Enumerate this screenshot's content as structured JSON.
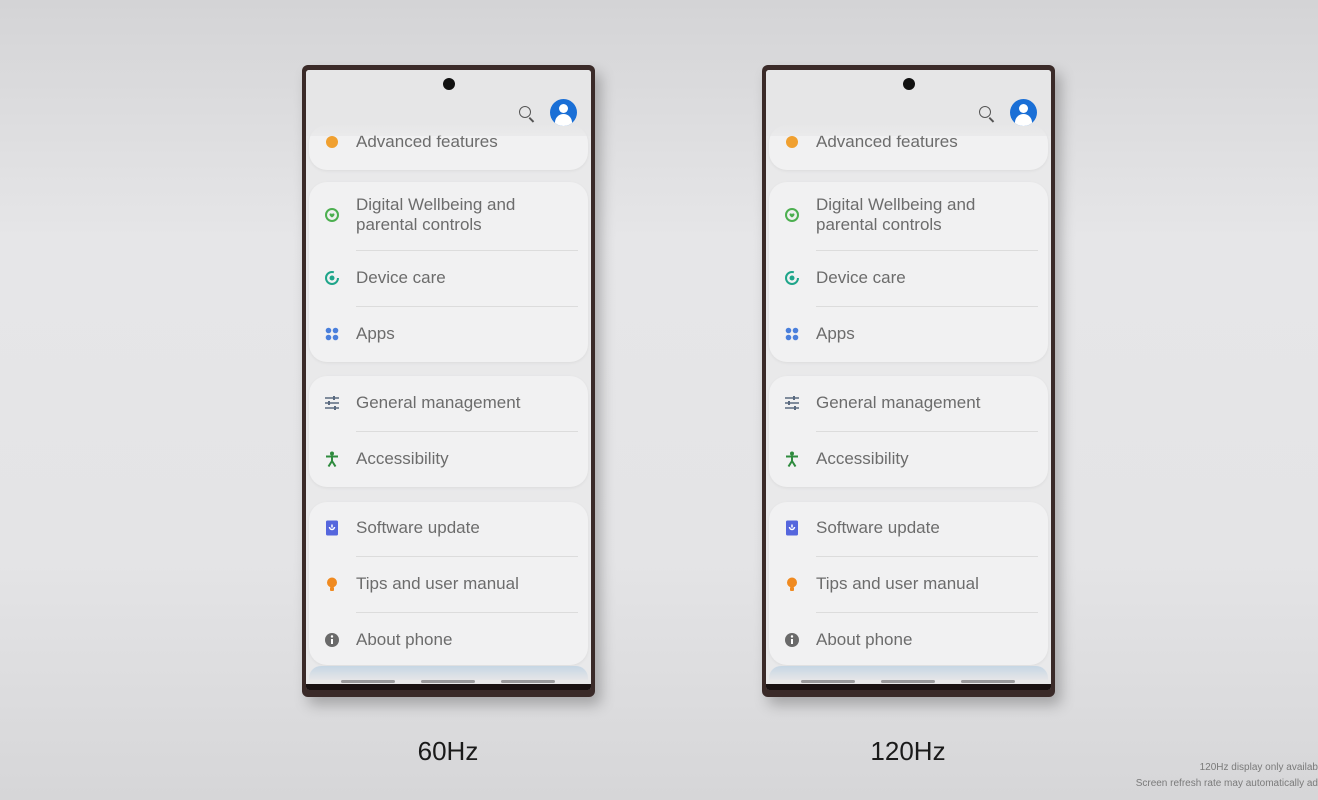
{
  "phones": [
    {
      "label": "60Hz"
    },
    {
      "label": "120Hz"
    }
  ],
  "settings": {
    "partial_item": {
      "label": "Advanced features",
      "icon": "advanced-features-icon",
      "color": "#f0a030"
    },
    "groups": [
      [
        {
          "label": "Digital Wellbeing and parental controls",
          "icon": "digital-wellbeing-icon",
          "color": "#4caf50"
        },
        {
          "label": "Device care",
          "icon": "device-care-icon",
          "color": "#1fa58a"
        },
        {
          "label": "Apps",
          "icon": "apps-icon",
          "color": "#4a7fdc"
        }
      ],
      [
        {
          "label": "General management",
          "icon": "sliders-icon",
          "color": "#5a6a80"
        },
        {
          "label": "Accessibility",
          "icon": "accessibility-icon",
          "color": "#2e8b3e"
        }
      ],
      [
        {
          "label": "Software update",
          "icon": "software-update-icon",
          "color": "#5566dd"
        },
        {
          "label": "Tips and user manual",
          "icon": "lightbulb-icon",
          "color": "#f08a20"
        },
        {
          "label": "About phone",
          "icon": "info-icon",
          "color": "#6a6a6a"
        }
      ]
    ],
    "accent": "#1a6fd6"
  },
  "disclaimer": {
    "line1": "120Hz display only availab",
    "line2": "Screen refresh rate may automatically ad"
  }
}
